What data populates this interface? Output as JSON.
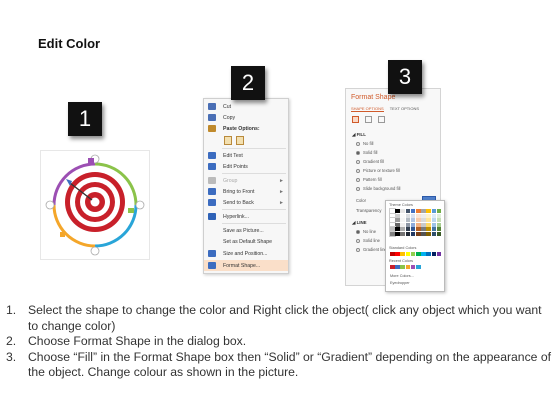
{
  "title": "Edit Color",
  "badges": [
    "1",
    "2",
    "3"
  ],
  "context_menu": {
    "items": [
      {
        "label": "Cut",
        "icon": "scissors-icon",
        "color": "#4a6fb5"
      },
      {
        "label": "Copy",
        "icon": "copy-icon",
        "color": "#4a6fb5"
      },
      {
        "label": "Paste Options:",
        "icon": "paste-icon",
        "color": "#c08a2c"
      },
      {
        "label": "Edit Text",
        "icon": "edit-text-icon",
        "color": "#3c6cc0"
      },
      {
        "label": "Edit Points",
        "icon": "edit-points-icon",
        "color": "#3c6cc0"
      },
      {
        "label": "Group",
        "icon": "group-icon",
        "color": "#888888",
        "disabled": true
      },
      {
        "label": "Bring to Front",
        "icon": "bring-front-icon",
        "color": "#3c6cc0"
      },
      {
        "label": "Send to Back",
        "icon": "send-back-icon",
        "color": "#3c6cc0"
      },
      {
        "label": "Hyperlink...",
        "icon": "hyperlink-icon",
        "color": "#2f62b7"
      },
      {
        "label": "Save as Picture...",
        "icon": "",
        "color": ""
      },
      {
        "label": "Set as Default Shape",
        "icon": "",
        "color": ""
      },
      {
        "label": "Size and Position...",
        "icon": "size-position-icon",
        "color": "#3c6cc0"
      },
      {
        "label": "Format Shape...",
        "icon": "format-shape-icon",
        "color": "#3c6cc0"
      }
    ]
  },
  "format_pane": {
    "title": "Format Shape",
    "tabs": [
      "SHAPE OPTIONS",
      "TEXT OPTIONS"
    ],
    "fill_header": "FILL",
    "fill_options": [
      "No fill",
      "Solid fill",
      "Gradient fill",
      "Picture or texture fill",
      "Pattern fill",
      "Slide background fill"
    ],
    "color_label": "Color",
    "transparency_label": "Transparency",
    "line_header": "LINE",
    "line_options": [
      "No line",
      "Solid line",
      "Gradient line"
    ],
    "palette": {
      "theme_label": "Theme Colors",
      "standard_label": "Standard Colors",
      "recent_label": "Recent Colors",
      "more_colors": "More Colors...",
      "eyedropper": "Eyedropper"
    }
  },
  "steps": [
    {
      "num": "1.",
      "text": "Select the shape to change the color and Right click the object( click any object which you want to change color)"
    },
    {
      "num": "2.",
      "text": "Choose Format Shape in the dialog box."
    },
    {
      "num": "3.",
      "text": "Choose “Fill” in the Format Shape box then “Solid” or “Gradient” depending on the appearance of the object. Change colour as shown in the picture."
    }
  ]
}
